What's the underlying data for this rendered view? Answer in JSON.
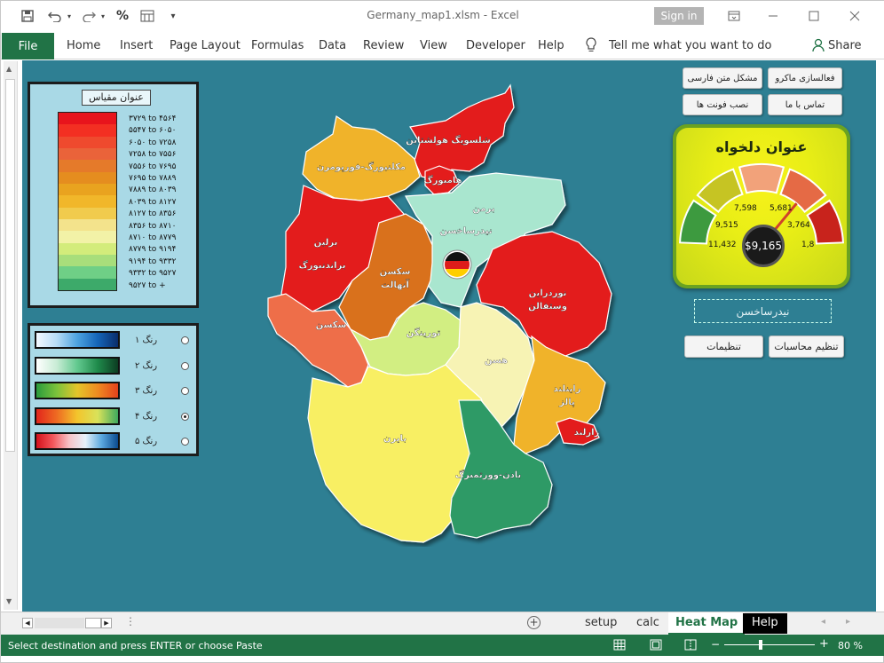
{
  "window": {
    "filename": "Germany_map1.xlsm",
    "separator": "-",
    "app": "Excel",
    "title": "Germany_map1.xlsm  -  Excel",
    "signin": "Sign in"
  },
  "qat": {
    "save": "save-icon",
    "undo": "undo-icon",
    "redo": "redo-icon",
    "percent": "%",
    "format": "format-icon",
    "customize": "customize-icon"
  },
  "ribbon": {
    "file": "File",
    "tabs": [
      "Home",
      "Insert",
      "Page Layout",
      "Formulas",
      "Data",
      "Review",
      "View",
      "Developer",
      "Help"
    ],
    "tell_me": "Tell me what you want to do",
    "share": "Share"
  },
  "legend": {
    "title": "عنوان مقیاس",
    "colors": [
      "#e8141c",
      "#f32f22",
      "#ef4a2e",
      "#ea633a",
      "#e57a2a",
      "#e58d1f",
      "#e9a31f",
      "#f1b72a",
      "#f1cb4d",
      "#f3e38c",
      "#f2f2a7",
      "#d3ec7b",
      "#a8de7b",
      "#6fcf86",
      "#3daa6a"
    ],
    "labels": [
      "۳۷۲۹ to ۴۵۶۴",
      "۵۵۴۷ to ۶۰۵۰",
      "۶۰۵۰ to ۷۲۵۸",
      "۷۲۵۸ to ۷۵۵۶",
      "۷۵۵۶ to ۷۶۹۵",
      "۷۶۹۵ to ۷۸۸۹",
      "۷۸۸۹ to ۸۰۳۹",
      "۸۰۳۹ to ۸۱۲۷",
      "۸۱۲۷ to ۸۳۵۶",
      "۸۳۵۶ to ۸۷۱۰",
      "۸۷۱۰ to ۸۷۷۹",
      "۸۷۷۹ to ۹۱۹۴",
      "۹۱۹۴ to ۹۳۳۲",
      "۹۳۳۲ to ۹۵۲۷",
      "۹۵۲۷ to +"
    ]
  },
  "schemes": {
    "items": [
      {
        "label": "رنگ ۱",
        "gradient": "linear-gradient(90deg,#f4f9ff,#b7dcf6,#4da3e0,#1565b8,#0a2d6b)",
        "selected": false
      },
      {
        "label": "رنگ ۲",
        "gradient": "linear-gradient(90deg,#ffffff,#c8ecd5,#62c98f,#1f8a4b,#0c3d22)",
        "selected": false
      },
      {
        "label": "رنگ ۳",
        "gradient": "linear-gradient(90deg,#2b9b3c,#7cc23b,#e4c52a,#ef8b21,#e2421c)",
        "selected": false
      },
      {
        "label": "رنگ ۴",
        "gradient": "linear-gradient(90deg,#e2261c,#ee6b22,#f3c52c,#d9e25a,#3fa95e)",
        "selected": true
      },
      {
        "label": "رنگ ۵",
        "gradient": "linear-gradient(90deg,#d3111b,#f2555a,#f7c2c6,#e7f1fa,#5aa7de,#0b4a8f)",
        "selected": false
      }
    ]
  },
  "buttons": {
    "macro": "فعالسازی ماکرو",
    "persian_text": "مشکل متن فارسی",
    "contact": "تماس با ما",
    "install_font": "نصب فونت ها",
    "calc_settings": "تنظیم محاسبات",
    "settings": "تنظیمات"
  },
  "gauge": {
    "title": "عنوان دلخواه",
    "value": "$9,165",
    "labels": [
      "11,432",
      "9,515",
      "7,598",
      "5,681",
      "3,764",
      "1,8"
    ],
    "colors": [
      "#3d9a3f",
      "#c6c423",
      "#f2a27a",
      "#e56a45",
      "#c8231c"
    ]
  },
  "selected_cell": "نیدرساخسن",
  "regions": [
    {
      "name": "شلسویگ هولشتاین",
      "line2": "",
      "color": "#e31a1c"
    },
    {
      "name": "هامبورگ",
      "line2": "",
      "color": "#e31a1c"
    },
    {
      "name": "مکلنبورگ-فورپومرن",
      "line2": "",
      "color": "#f0b32a"
    },
    {
      "name": "برمن",
      "line2": "",
      "color": "#a9e6cf"
    },
    {
      "name": "نیدرساخسن",
      "line2": "",
      "color": "#a9e6cf"
    },
    {
      "name": "برلین",
      "line2": "",
      "color": "#e31a1c"
    },
    {
      "name": "براندنبورگ",
      "line2": "",
      "color": "#e31a1c"
    },
    {
      "name": "سکسن",
      "line2": "آنهالت",
      "color": "#d9711c"
    },
    {
      "name": "نوردراین",
      "line2": "وستفالن",
      "color": "#e31a1c"
    },
    {
      "name": "سکسن",
      "line2": "",
      "color": "#ee6e4a"
    },
    {
      "name": "تورینگن",
      "line2": "",
      "color": "#d2ee82"
    },
    {
      "name": "هسن",
      "line2": "",
      "color": "#f7f3b4"
    },
    {
      "name": "راینلند",
      "line2": "پالز",
      "color": "#f0b32a"
    },
    {
      "name": "زارلند",
      "line2": "",
      "color": "#e31a1c"
    },
    {
      "name": "بایرن",
      "line2": "",
      "color": "#f8ef64"
    },
    {
      "name": "بادن-وورتمبرگ",
      "line2": "",
      "color": "#2f9a66"
    }
  ],
  "sheet_tabs": [
    "setup",
    "calc",
    "Heat Map",
    "Help"
  ],
  "status": {
    "message": "Select destination and press ENTER or choose Paste",
    "zoom": "80 %"
  }
}
